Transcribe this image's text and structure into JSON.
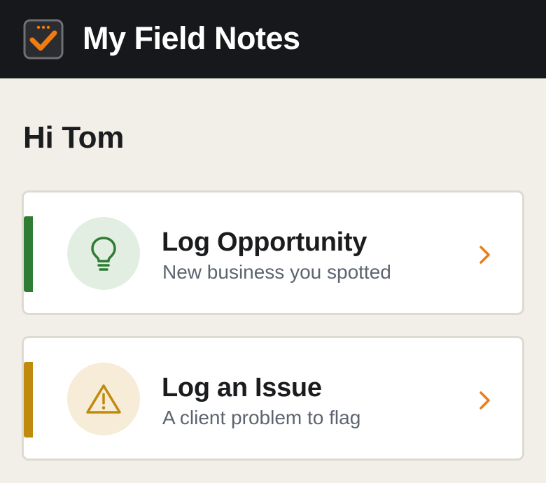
{
  "header": {
    "app_title": "My Field Notes",
    "logo_icon": "checkbox-check-icon",
    "background": "#16181b",
    "accent": "#f07b12"
  },
  "greeting": "Hi Tom",
  "actions": [
    {
      "title": "Log Opportunity",
      "subtitle": "New business you spotted",
      "icon": "lightbulb-icon",
      "accent_color": "#2e7d32",
      "chevron_icon": "chevron-right-icon"
    },
    {
      "title": "Log an Issue",
      "subtitle": "A client problem to flag",
      "icon": "warning-triangle-icon",
      "accent_color": "#c08a0d",
      "chevron_icon": "chevron-right-icon"
    }
  ]
}
